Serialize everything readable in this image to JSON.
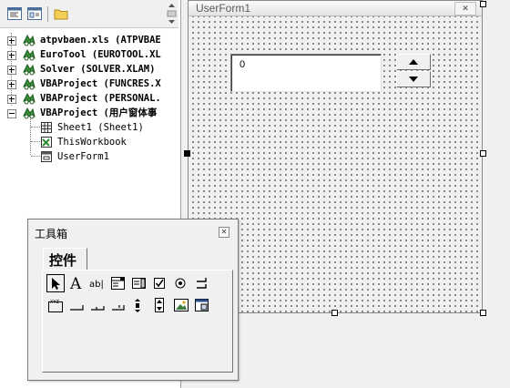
{
  "explorer": {
    "toolbar": {
      "icons": [
        "view-code-icon",
        "view-object-icon",
        "toggle-folders-icon"
      ]
    },
    "tree": [
      {
        "label": "atpvbaen.xls (ATPVBAE",
        "level": 0,
        "expander": "plus",
        "bold": true
      },
      {
        "label": "EuroTool (EUROTOOL.XL",
        "level": 0,
        "expander": "plus",
        "bold": true
      },
      {
        "label": "Solver (SOLVER.XLAM)",
        "level": 0,
        "expander": "plus",
        "bold": true
      },
      {
        "label": "VBAProject (FUNCRES.X",
        "level": 0,
        "expander": "plus",
        "bold": true
      },
      {
        "label": "VBAProject (PERSONAL.",
        "level": 0,
        "expander": "plus",
        "bold": true
      },
      {
        "label": "VBAProject (用户窗体事",
        "level": 0,
        "expander": "minus",
        "bold": true
      },
      {
        "label": "Sheet1 (Sheet1)",
        "level": 1,
        "icon": "worksheet-icon",
        "bold": false
      },
      {
        "label": "ThisWorkbook",
        "level": 1,
        "icon": "workbook-icon",
        "bold": false
      },
      {
        "label": "UserForm1",
        "level": 1,
        "icon": "userform-icon",
        "bold": false
      }
    ]
  },
  "userform": {
    "title": "UserForm1",
    "close_glyph": "✕",
    "textbox": {
      "value": "0"
    },
    "spinbutton": {
      "up_icon": "triangle-up-icon",
      "down_icon": "triangle-down-icon"
    }
  },
  "toolbox": {
    "title": "工具箱",
    "close_glyph": "✕",
    "tab_label": "控件",
    "tools": [
      {
        "name": "select-objects-tool",
        "icon": "arrow-pointer-icon",
        "selected": true
      },
      {
        "name": "label-tool",
        "icon": "label-a-icon",
        "glyph": "A"
      },
      {
        "name": "textbox-tool",
        "icon": "textbox-abl-icon",
        "glyph": "ab|"
      },
      {
        "name": "combobox-tool",
        "icon": "combobox-icon"
      },
      {
        "name": "listbox-tool",
        "icon": "listbox-icon"
      },
      {
        "name": "checkbox-tool",
        "icon": "checkbox-icon"
      },
      {
        "name": "optionbutton-tool",
        "icon": "option-button-icon"
      },
      {
        "name": "togglebutton-tool",
        "icon": "toggle-button-icon"
      },
      {
        "name": "frame-tool",
        "icon": "frame-icon",
        "glyph": "XYZ"
      },
      {
        "name": "commandbutton-tool",
        "icon": "command-button-icon"
      },
      {
        "name": "tabstrip-tool",
        "icon": "tabstrip-icon"
      },
      {
        "name": "multipage-tool",
        "icon": "multipage-icon"
      },
      {
        "name": "scrollbar-tool",
        "icon": "scrollbar-icon"
      },
      {
        "name": "spinbutton-tool",
        "icon": "spin-button-icon"
      },
      {
        "name": "image-tool",
        "icon": "image-icon"
      },
      {
        "name": "refedit-tool",
        "icon": "refedit-icon"
      }
    ]
  },
  "colors": {
    "selection_border": "#000000",
    "tree_project_icon": "#1f5a1f",
    "form_dot": "#000000"
  }
}
